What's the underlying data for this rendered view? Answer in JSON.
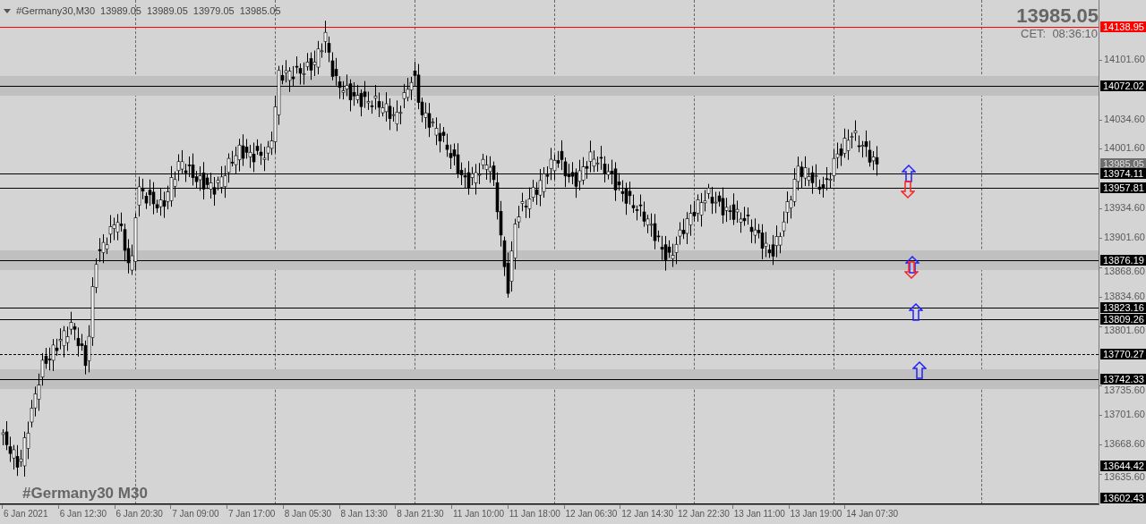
{
  "header": {
    "symbol": "#Germany30,M30",
    "ohlc": [
      "13989.05",
      "13989.05",
      "13979.05",
      "13985.05"
    ]
  },
  "quote": {
    "price": "13985.05",
    "time": "CET:  08:36:10"
  },
  "watermark": "#Germany30 M30",
  "price_axis": [
    "14101.60",
    "14034.60",
    "14001.60",
    "13934.60",
    "13901.60",
    "13868.60",
    "13834.60",
    "13801.60",
    "13735.60",
    "13701.60",
    "13668.60",
    "13635.60"
  ],
  "bid_label": "13985.05",
  "levels": [
    {
      "price": "14138.95",
      "color": "#ff0000",
      "kind": "line",
      "zone": false
    },
    {
      "price": "14072.02",
      "color": "#000000",
      "kind": "line",
      "zone": true
    },
    {
      "price": "13974.11",
      "color": "#000000",
      "kind": "line",
      "zone": false
    },
    {
      "price": "13957.81",
      "color": "#000000",
      "kind": "line",
      "zone": false
    },
    {
      "price": "13876.19",
      "color": "#000000",
      "kind": "line",
      "zone": true
    },
    {
      "price": "13823.16",
      "color": "#000000",
      "kind": "line",
      "zone": false
    },
    {
      "price": "13809.26",
      "color": "#000000",
      "kind": "line",
      "zone": false
    },
    {
      "price": "13770.27",
      "color": "#000000",
      "kind": "dashed",
      "zone": false
    },
    {
      "price": "13742.33",
      "color": "#000000",
      "kind": "line",
      "zone": true
    },
    {
      "price": "13644.42",
      "color": "#000000",
      "kind": "label",
      "zone": false
    },
    {
      "price": "13602.43",
      "color": "#000000",
      "kind": "line",
      "zone": false
    }
  ],
  "signals": [
    {
      "kind": "up"
    },
    {
      "kind": "down"
    },
    {
      "kind": "up"
    },
    {
      "kind": "down"
    },
    {
      "kind": "up"
    },
    {
      "kind": "up"
    }
  ],
  "time_axis": [
    "6 Jan 2021",
    "6 Jan 12:30",
    "6 Jan 20:30",
    "7 Jan 09:00",
    "7 Jan 17:00",
    "8 Jan 05:30",
    "8 Jan 13:30",
    "8 Jan 21:30",
    "11 Jan 10:00",
    "11 Jan 18:00",
    "12 Jan 06:30",
    "12 Jan 14:30",
    "12 Jan 22:30",
    "13 Jan 11:00",
    "13 Jan 19:00",
    "14 Jan 07:30"
  ]
}
